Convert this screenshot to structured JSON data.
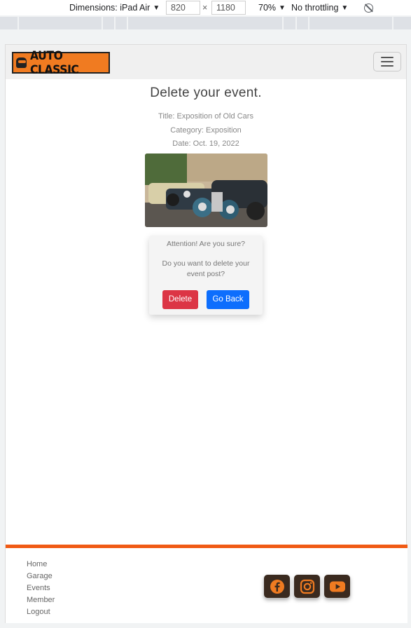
{
  "devtools": {
    "dimensions_label": "Dimensions: iPad Air",
    "width": "820",
    "height": "1180",
    "times": "×",
    "zoom": "70%",
    "throttling": "No throttling"
  },
  "navbar": {
    "logo_text": "AUTO CLASSIC"
  },
  "main": {
    "heading": "Delete your event.",
    "title_line": "Title: Exposition of Old Cars",
    "category_line": "Category: Exposition",
    "date_line": "Date: Oct. 19, 2022",
    "image_alt": "Exposition of Old Cars"
  },
  "confirm": {
    "question": "Attention! Are you sure?",
    "message": "Do you want to delete your event post?",
    "delete_label": "Delete",
    "back_label": "Go Back"
  },
  "footer": {
    "links": [
      "Home",
      "Garage",
      "Events",
      "Member",
      "Logout"
    ],
    "social": [
      "facebook-icon",
      "instagram-icon",
      "youtube-icon"
    ],
    "accent": "#f05a14"
  },
  "colors": {
    "delete": "#dc3545",
    "go_back": "#0d6efd",
    "brand": "#f07b21"
  }
}
